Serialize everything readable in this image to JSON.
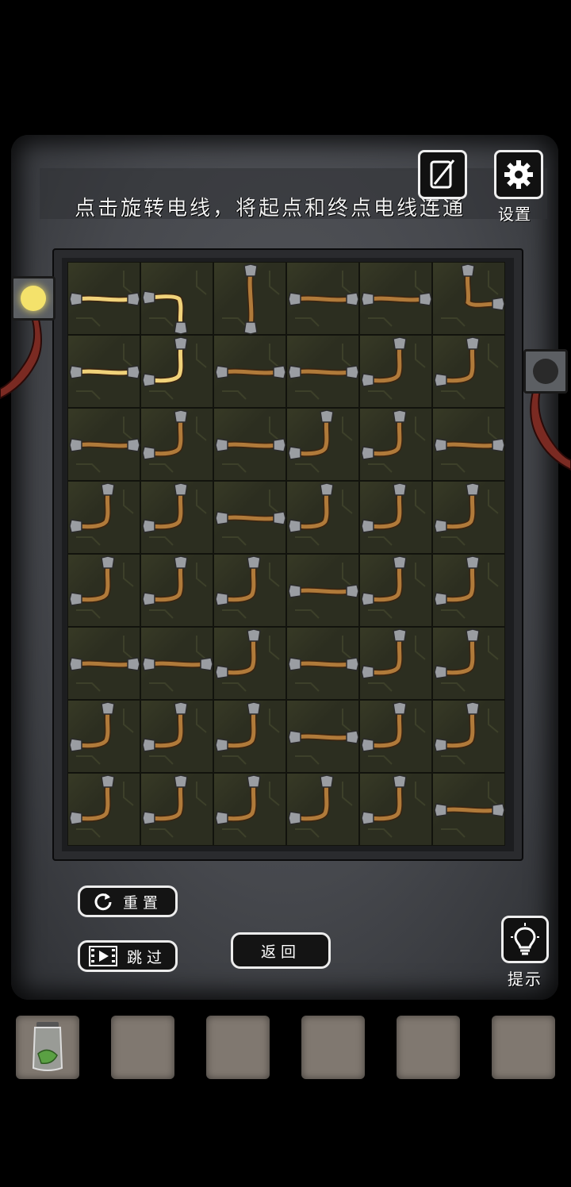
{
  "instruction": "点击旋转电线，将起点和终点电线连通",
  "top_buttons": {
    "notes_icon": "notebook-pencil-icon",
    "settings_icon": "gear-icon",
    "settings_label": "设置"
  },
  "board": {
    "rows": 8,
    "cols": 6,
    "start_bulb_color": "#f4e26b",
    "end_bulb_color": "#2a2a2a",
    "wire_color": "#b07a3a",
    "lit_wire_color": "#f0d27a",
    "tiles": [
      [
        "straight-h-lit",
        "corner-left-down-lit",
        "straight-v",
        "straight-h",
        "straight-h",
        "corner-up-right"
      ],
      [
        "straight-h-lit",
        "corner-left-up-lit",
        "straight-h",
        "straight-h",
        "corner-left-up",
        "corner-left-up"
      ],
      [
        "straight-h",
        "corner-left-up",
        "straight-h",
        "corner-left-up",
        "corner-left-up",
        "straight-h"
      ],
      [
        "corner-left-up",
        "corner-left-up",
        "straight-h",
        "corner-left-up",
        "corner-left-up",
        "corner-left-up"
      ],
      [
        "corner-left-up",
        "corner-left-up",
        "corner-left-up",
        "straight-h",
        "corner-left-up",
        "corner-left-up"
      ],
      [
        "straight-h",
        "straight-h",
        "corner-left-up",
        "straight-h",
        "corner-left-up",
        "corner-left-up"
      ],
      [
        "corner-left-up",
        "corner-left-up",
        "corner-left-up",
        "straight-h",
        "corner-left-up",
        "corner-left-up"
      ],
      [
        "corner-left-up",
        "corner-left-up",
        "corner-left-up",
        "corner-left-up",
        "corner-left-up",
        "straight-h"
      ]
    ]
  },
  "buttons": {
    "reset_label": "重置",
    "skip_label": "跳过",
    "back_label": "返回",
    "hint_label": "提示"
  },
  "inventory": {
    "slots": [
      {
        "item": "glass-jar-with-green-leaf"
      },
      {
        "item": ""
      },
      {
        "item": ""
      },
      {
        "item": ""
      },
      {
        "item": ""
      },
      {
        "item": ""
      }
    ]
  }
}
